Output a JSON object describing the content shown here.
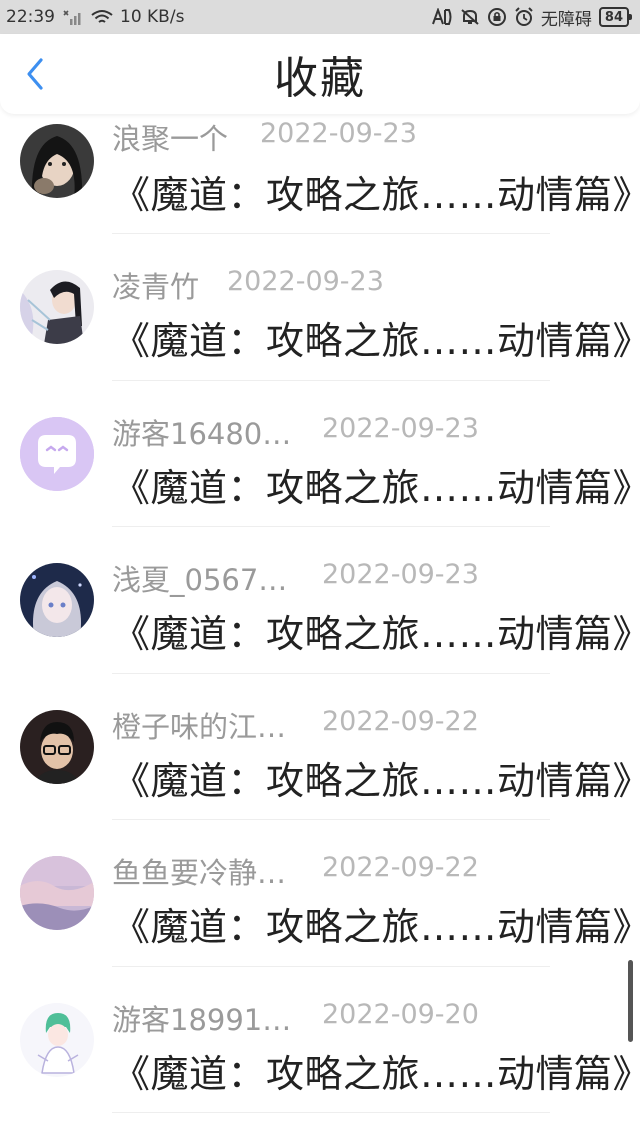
{
  "status_bar": {
    "time": "22:39",
    "network_speed": "10 KB/s",
    "accessibility": "无障碍",
    "battery": "84"
  },
  "header": {
    "title": "收藏",
    "back_icon": "chevron-left-icon",
    "accent_color": "#3d8ff0"
  },
  "items": [
    {
      "user": "浪聚一个",
      "date": "2022-09-23",
      "title": "《魔道：攻略之旅……动情篇》"
    },
    {
      "user": "凌青竹",
      "date": "2022-09-23",
      "title": "《魔道：攻略之旅……动情篇》"
    },
    {
      "user": "游客16480…",
      "date": "2022-09-23",
      "title": "《魔道：攻略之旅……动情篇》"
    },
    {
      "user": "浅夏_0567…",
      "date": "2022-09-23",
      "title": "《魔道：攻略之旅……动情篇》"
    },
    {
      "user": "橙子味的江…",
      "date": "2022-09-22",
      "title": "《魔道：攻略之旅……动情篇》"
    },
    {
      "user": "鱼鱼要冷静…",
      "date": "2022-09-22",
      "title": "《魔道：攻略之旅……动情篇》"
    },
    {
      "user": "游客18991…",
      "date": "2022-09-20",
      "title": "《魔道：攻略之旅……动情篇》"
    }
  ]
}
